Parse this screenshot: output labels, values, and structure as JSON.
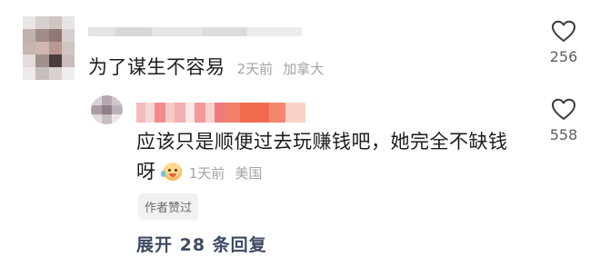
{
  "comments": [
    {
      "text": "为了谋生不容易",
      "time": "2天前",
      "location": "加拿大",
      "like_count": "256",
      "icon": "heart-outline-icon"
    }
  ],
  "reply": {
    "text_line1": "应该只是顺便过去玩赚钱吧，她完全不缺钱",
    "text_line2": "呀",
    "emoji": "crying-laugh-emoji",
    "time": "1天前",
    "location": "美国",
    "like_count": "558",
    "badge": "作者赞过",
    "icon": "heart-outline-icon"
  },
  "expand_label": "展开 28 条回复",
  "colors": {
    "text": "#1c1c1c",
    "meta": "#a3a3a3",
    "expand": "#3f4a64",
    "badge_bg": "#f1f1f1"
  }
}
